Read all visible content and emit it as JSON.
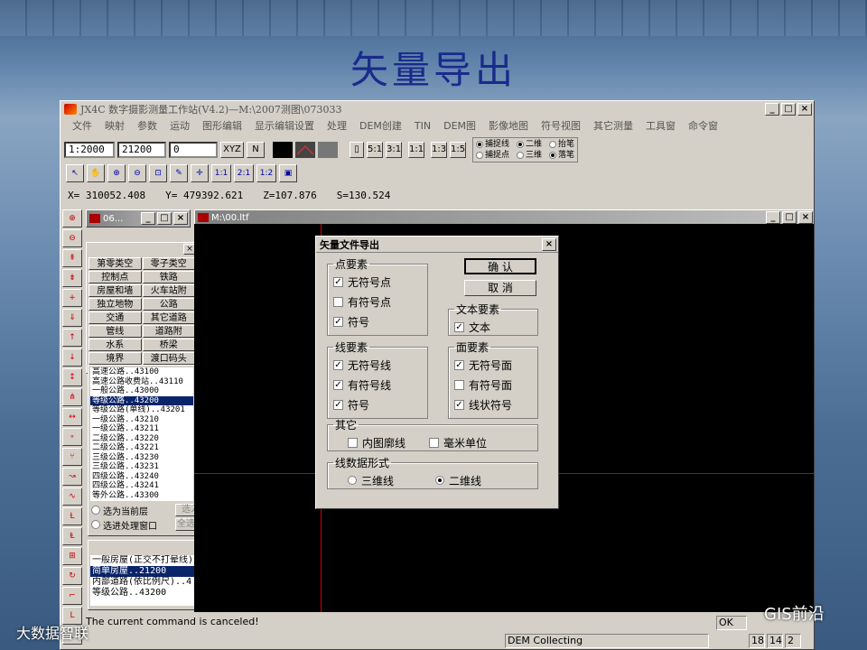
{
  "slide": {
    "title": "矢量导出"
  },
  "app": {
    "title": "JX4C 数字摄影测量工作站(V4.2)—M:\\2007测图\\073033",
    "menu": [
      "文件",
      "映射",
      "参数",
      "运动",
      "图形编辑",
      "显示编辑设置",
      "处理",
      "DEM创建",
      "TIN",
      "DEM图",
      "影像地图",
      "符号视图",
      "其它测量",
      "工具窗",
      "命令窗"
    ],
    "toolbar1": {
      "scale": "1:2000",
      "code": "21200",
      "value": "0",
      "xyz_label": "XYZ",
      "n_label": "N",
      "ratios": [
        "5:1",
        "3:1",
        "1:1",
        "1:3",
        "1:5"
      ],
      "radios": [
        {
          "label": "捕捉线",
          "checked": true
        },
        {
          "label": "二维",
          "checked": true
        },
        {
          "label": "抬笔",
          "checked": false
        },
        {
          "label": "捕捉点",
          "checked": false
        },
        {
          "label": "三维",
          "checked": false
        },
        {
          "label": "落笔",
          "checked": true
        }
      ]
    },
    "toolbar2": {
      "zoom_labels": [
        "1:1",
        "2:1",
        "1:2"
      ]
    },
    "coords": {
      "x": "X= 310052.408",
      "y": "Y= 479392.621",
      "z": "Z=107.876",
      "s": "S=130.524"
    },
    "sub_window": {
      "title": "06..."
    },
    "categories": [
      "第零类空",
      "零子类空",
      "控制点",
      "铁路",
      "房屋和墙",
      "火车站附",
      "独立地物",
      "公路",
      "交通",
      "其它道路",
      "管线",
      "道路附",
      "水系",
      "桥梁",
      "境界",
      "渡口码头"
    ],
    "road_list": {
      "items": [
        "高速公路..43100",
        "高速公路收费站..43110",
        "一般公路..43000",
        "等级公路..43200",
        "等级公路(单线)..43201",
        "一级公路..43210",
        "一级公路..43211",
        "二级公路..43220",
        "二级公路..43221",
        "三级公路..43230",
        "三级公路..43231",
        "四级公路..43240",
        "四级公路..43241",
        "等外公路..43300"
      ],
      "selected_index": 3,
      "opt_current_layer": "选为当前层",
      "opt_process_window": "选进处理窗口",
      "btn_select": "选入",
      "btn_select_all": "全选入"
    },
    "recent_list": {
      "items": [
        "一般房屋(正交不打晕线)",
        "简单房屋..21200",
        "内部道路(依比例尺)..4",
        "等级公路..43200"
      ],
      "selected_index": 1
    },
    "canvas_window": {
      "title": "M:\\00.ltf"
    },
    "status": {
      "message": "The current command is canceled!",
      "ok": "OK",
      "mode": "DEM Collecting",
      "n1": "18",
      "n2": "14",
      "n3": "2"
    }
  },
  "dialog": {
    "title": "矢量文件导出",
    "ok": "确  认",
    "cancel": "取  消",
    "point_group": {
      "legend": "点要素",
      "items": [
        {
          "label": "无符号点",
          "checked": true
        },
        {
          "label": "有符号点",
          "checked": false
        },
        {
          "label": "符号",
          "checked": true
        }
      ]
    },
    "text_group": {
      "legend": "文本要素",
      "items": [
        {
          "label": "文本",
          "checked": true
        }
      ]
    },
    "line_group": {
      "legend": "线要素",
      "items": [
        {
          "label": "无符号线",
          "checked": true
        },
        {
          "label": "有符号线",
          "checked": true
        },
        {
          "label": "符号",
          "checked": true
        }
      ]
    },
    "area_group": {
      "legend": "面要素",
      "items": [
        {
          "label": "无符号面",
          "checked": true
        },
        {
          "label": "有符号面",
          "checked": false
        },
        {
          "label": "线状符号",
          "checked": true
        }
      ]
    },
    "other_group": {
      "legend": "其它",
      "items": [
        {
          "label": "内图廓线",
          "checked": false
        },
        {
          "label": "毫米单位",
          "checked": false
        }
      ]
    },
    "linefmt_group": {
      "legend": "线数据形式",
      "items": [
        {
          "label": "三维线",
          "checked": false
        },
        {
          "label": "二维线",
          "checked": true
        }
      ]
    }
  },
  "watermarks": {
    "left": "大数据智联",
    "right": "GIS前沿"
  }
}
